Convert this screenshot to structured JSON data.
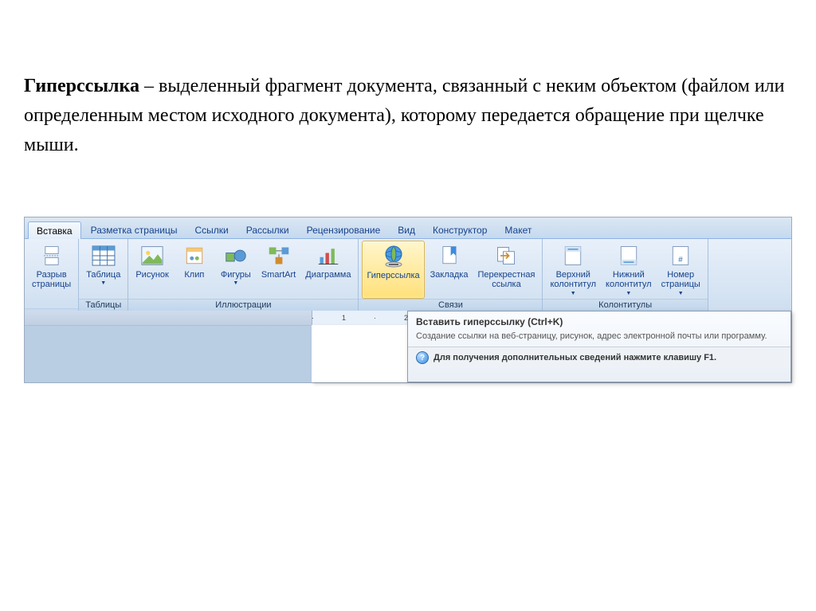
{
  "text": {
    "term": "Гиперссылка",
    "definition_rest": " – выделенный фрагмент документа, связанный с неким объектом (файлом или определенным местом исходного документа), которому передается обращение при щелчке мыши."
  },
  "ribbon": {
    "tabs": [
      {
        "label": "Вставка",
        "active": true
      },
      {
        "label": "Разметка страницы",
        "active": false
      },
      {
        "label": "Ссылки",
        "active": false
      },
      {
        "label": "Рассылки",
        "active": false
      },
      {
        "label": "Рецензирование",
        "active": false
      },
      {
        "label": "Вид",
        "active": false
      },
      {
        "label": "Конструктор",
        "active": false
      },
      {
        "label": "Макет",
        "active": false
      }
    ],
    "groups": [
      {
        "label": "",
        "items": [
          {
            "label": "Разрыв страницы",
            "icon": "page-break",
            "dropdown": false
          }
        ]
      },
      {
        "label": "Таблицы",
        "items": [
          {
            "label": "Таблица",
            "icon": "table",
            "dropdown": true
          }
        ]
      },
      {
        "label": "Иллюстрации",
        "items": [
          {
            "label": "Рисунок",
            "icon": "picture",
            "dropdown": false
          },
          {
            "label": "Клип",
            "icon": "clip",
            "dropdown": false
          },
          {
            "label": "Фигуры",
            "icon": "shapes",
            "dropdown": true
          },
          {
            "label": "SmartArt",
            "icon": "smartart",
            "dropdown": false
          },
          {
            "label": "Диаграмма",
            "icon": "chart",
            "dropdown": false
          }
        ]
      },
      {
        "label": "Связи",
        "items": [
          {
            "label": "Гиперссылка",
            "icon": "hyperlink",
            "dropdown": false,
            "highlighted": true
          },
          {
            "label": "Закладка",
            "icon": "bookmark",
            "dropdown": false
          },
          {
            "label": "Перекрестная ссылка",
            "icon": "crossref",
            "dropdown": false
          }
        ]
      },
      {
        "label": "Колонтитулы",
        "items": [
          {
            "label": "Верхний колонтитул",
            "icon": "header",
            "dropdown": true
          },
          {
            "label": "Нижний колонтитул",
            "icon": "footer",
            "dropdown": true
          },
          {
            "label": "Номер страницы",
            "icon": "pagenum",
            "dropdown": true
          }
        ]
      }
    ]
  },
  "ruler": {
    "mark1": "1",
    "mark2": "2"
  },
  "tooltip": {
    "title": "Вставить гиперссылку (Ctrl+K)",
    "body": "Создание ссылки на веб-страницу, рисунок, адрес электронной почты или программу.",
    "footer": "Для получения дополнительных сведений нажмите клавишу F1."
  }
}
